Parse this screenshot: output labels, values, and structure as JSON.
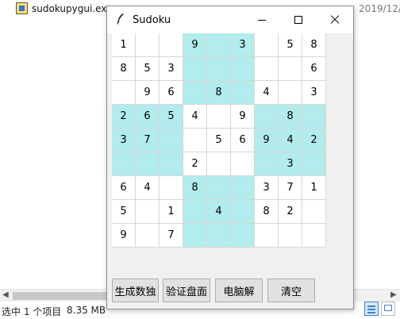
{
  "explorer": {
    "file_name": "sudokupygui.exe",
    "file_date": "2019/12/",
    "status_selected": "选中 1 个项目",
    "status_size": "8.35 MB",
    "scroll_left_icon": "chevron-left-icon",
    "scroll_right_icon": "chevron-right-icon"
  },
  "window": {
    "title": "Sudoku",
    "icon": "feather-icon"
  },
  "colors": {
    "shaded_cell": "#b3ecec",
    "window_bg": "#f0f0f0",
    "button_bg": "#e1e1e1"
  },
  "board": {
    "rows": [
      [
        "1",
        "",
        "",
        "9",
        "",
        "3",
        "",
        "5",
        "8"
      ],
      [
        "8",
        "5",
        "3",
        "",
        "",
        "",
        "",
        "",
        "6"
      ],
      [
        "",
        "9",
        "6",
        "",
        "8",
        "",
        "4",
        "",
        "3"
      ],
      [
        "2",
        "6",
        "5",
        "4",
        "",
        "9",
        "",
        "8",
        ""
      ],
      [
        "3",
        "7",
        "",
        "",
        "5",
        "6",
        "9",
        "4",
        "2"
      ],
      [
        "",
        "",
        "",
        "2",
        "",
        "",
        "",
        "3",
        ""
      ],
      [
        "6",
        "4",
        "",
        "8",
        "",
        "",
        "3",
        "7",
        "1"
      ],
      [
        "5",
        "",
        "1",
        "",
        "4",
        "",
        "8",
        "2",
        ""
      ],
      [
        "9",
        "",
        "7",
        "",
        "",
        "",
        "",
        "",
        ""
      ]
    ]
  },
  "buttons": {
    "generate": "生成数独",
    "verify": "验证盘面",
    "solve": "电脑解",
    "clear": "清空"
  }
}
